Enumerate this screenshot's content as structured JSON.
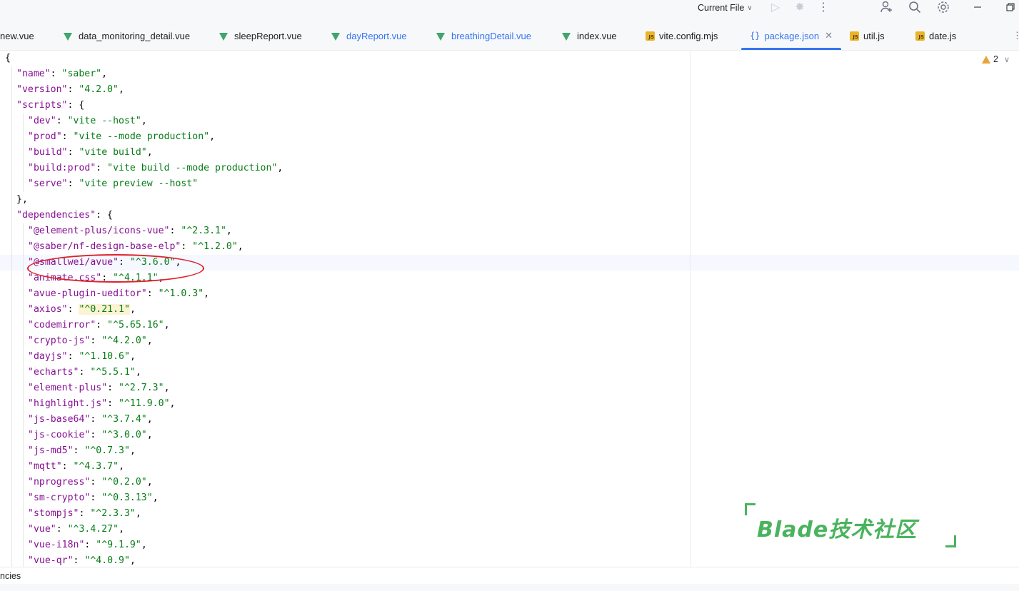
{
  "toolbar": {
    "run_config": "Current File",
    "icons": [
      "run-icon",
      "debug-icon",
      "more-icon",
      "add-user-icon",
      "search-icon",
      "settings-icon",
      "minimize-icon",
      "restore-icon"
    ]
  },
  "tabs": [
    {
      "label": "new.vue",
      "type": "vue"
    },
    {
      "label": "data_monitoring_detail.vue",
      "type": "vue"
    },
    {
      "label": "sleepReport.vue",
      "type": "vue"
    },
    {
      "label": "dayReport.vue",
      "type": "vue",
      "modified": true
    },
    {
      "label": "breathingDetail.vue",
      "type": "vue",
      "modified": true
    },
    {
      "label": "index.vue",
      "type": "vue"
    },
    {
      "label": "vite.config.mjs",
      "type": "js"
    },
    {
      "label": "package.json",
      "type": "json",
      "active": true
    },
    {
      "label": "util.js",
      "type": "js"
    },
    {
      "label": "date.js",
      "type": "js"
    }
  ],
  "editor": {
    "warnings_count": "2",
    "lines": [
      {
        "indent": 0,
        "text": "{"
      },
      {
        "indent": 1,
        "key": "name",
        "value": "saber"
      },
      {
        "indent": 1,
        "key": "version",
        "value": "4.2.0"
      },
      {
        "indent": 1,
        "key": "scripts",
        "open": "{"
      },
      {
        "indent": 2,
        "key": "dev",
        "value": "vite --host"
      },
      {
        "indent": 2,
        "key": "prod",
        "value": "vite --mode production"
      },
      {
        "indent": 2,
        "key": "build",
        "value": "vite build"
      },
      {
        "indent": 2,
        "key": "build:prod",
        "value": "vite build --mode production"
      },
      {
        "indent": 2,
        "key": "serve",
        "value": "vite preview --host",
        "last": true
      },
      {
        "indent": 1,
        "text": "},"
      },
      {
        "indent": 1,
        "key": "dependencies",
        "open": "{"
      },
      {
        "indent": 2,
        "key": "@element-plus/icons-vue",
        "value": "^2.3.1"
      },
      {
        "indent": 2,
        "key": "@saber/nf-design-base-elp",
        "value": "^1.2.0"
      },
      {
        "indent": 2,
        "key": "@smallwei/avue",
        "value": "^3.6.0"
      },
      {
        "indent": 2,
        "key": "animate.css",
        "value": "^4.1.1"
      },
      {
        "indent": 2,
        "key": "avue-plugin-ueditor",
        "value": "^1.0.3"
      },
      {
        "indent": 2,
        "key": "axios",
        "value": "^0.21.1",
        "highlight": true
      },
      {
        "indent": 2,
        "key": "codemirror",
        "value": "^5.65.16"
      },
      {
        "indent": 2,
        "key": "crypto-js",
        "value": "^4.2.0"
      },
      {
        "indent": 2,
        "key": "dayjs",
        "value": "^1.10.6"
      },
      {
        "indent": 2,
        "key": "echarts",
        "value": "^5.5.1"
      },
      {
        "indent": 2,
        "key": "element-plus",
        "value": "^2.7.3"
      },
      {
        "indent": 2,
        "key": "highlight.js",
        "value": "^11.9.0"
      },
      {
        "indent": 2,
        "key": "js-base64",
        "value": "^3.7.4"
      },
      {
        "indent": 2,
        "key": "js-cookie",
        "value": "^3.0.0"
      },
      {
        "indent": 2,
        "key": "js-md5",
        "value": "^0.7.3"
      },
      {
        "indent": 2,
        "key": "mqtt",
        "value": "^4.3.7"
      },
      {
        "indent": 2,
        "key": "nprogress",
        "value": "^0.2.0"
      },
      {
        "indent": 2,
        "key": "sm-crypto",
        "value": "^0.3.13"
      },
      {
        "indent": 2,
        "key": "stompjs",
        "value": "^2.3.3"
      },
      {
        "indent": 2,
        "key": "vue",
        "value": "^3.4.27"
      },
      {
        "indent": 2,
        "key": "vue-i18n",
        "value": "^9.1.9"
      },
      {
        "indent": 2,
        "key": "vue-qr",
        "value": "^4.0.9"
      }
    ]
  },
  "watermark": "Blade技术社区",
  "breadcrumb": "ncies",
  "colors": {
    "accent": "#3574f0",
    "string": "#067d17",
    "key": "#871094",
    "annotation": "#e0212b",
    "watermark": "#4ab35e"
  }
}
